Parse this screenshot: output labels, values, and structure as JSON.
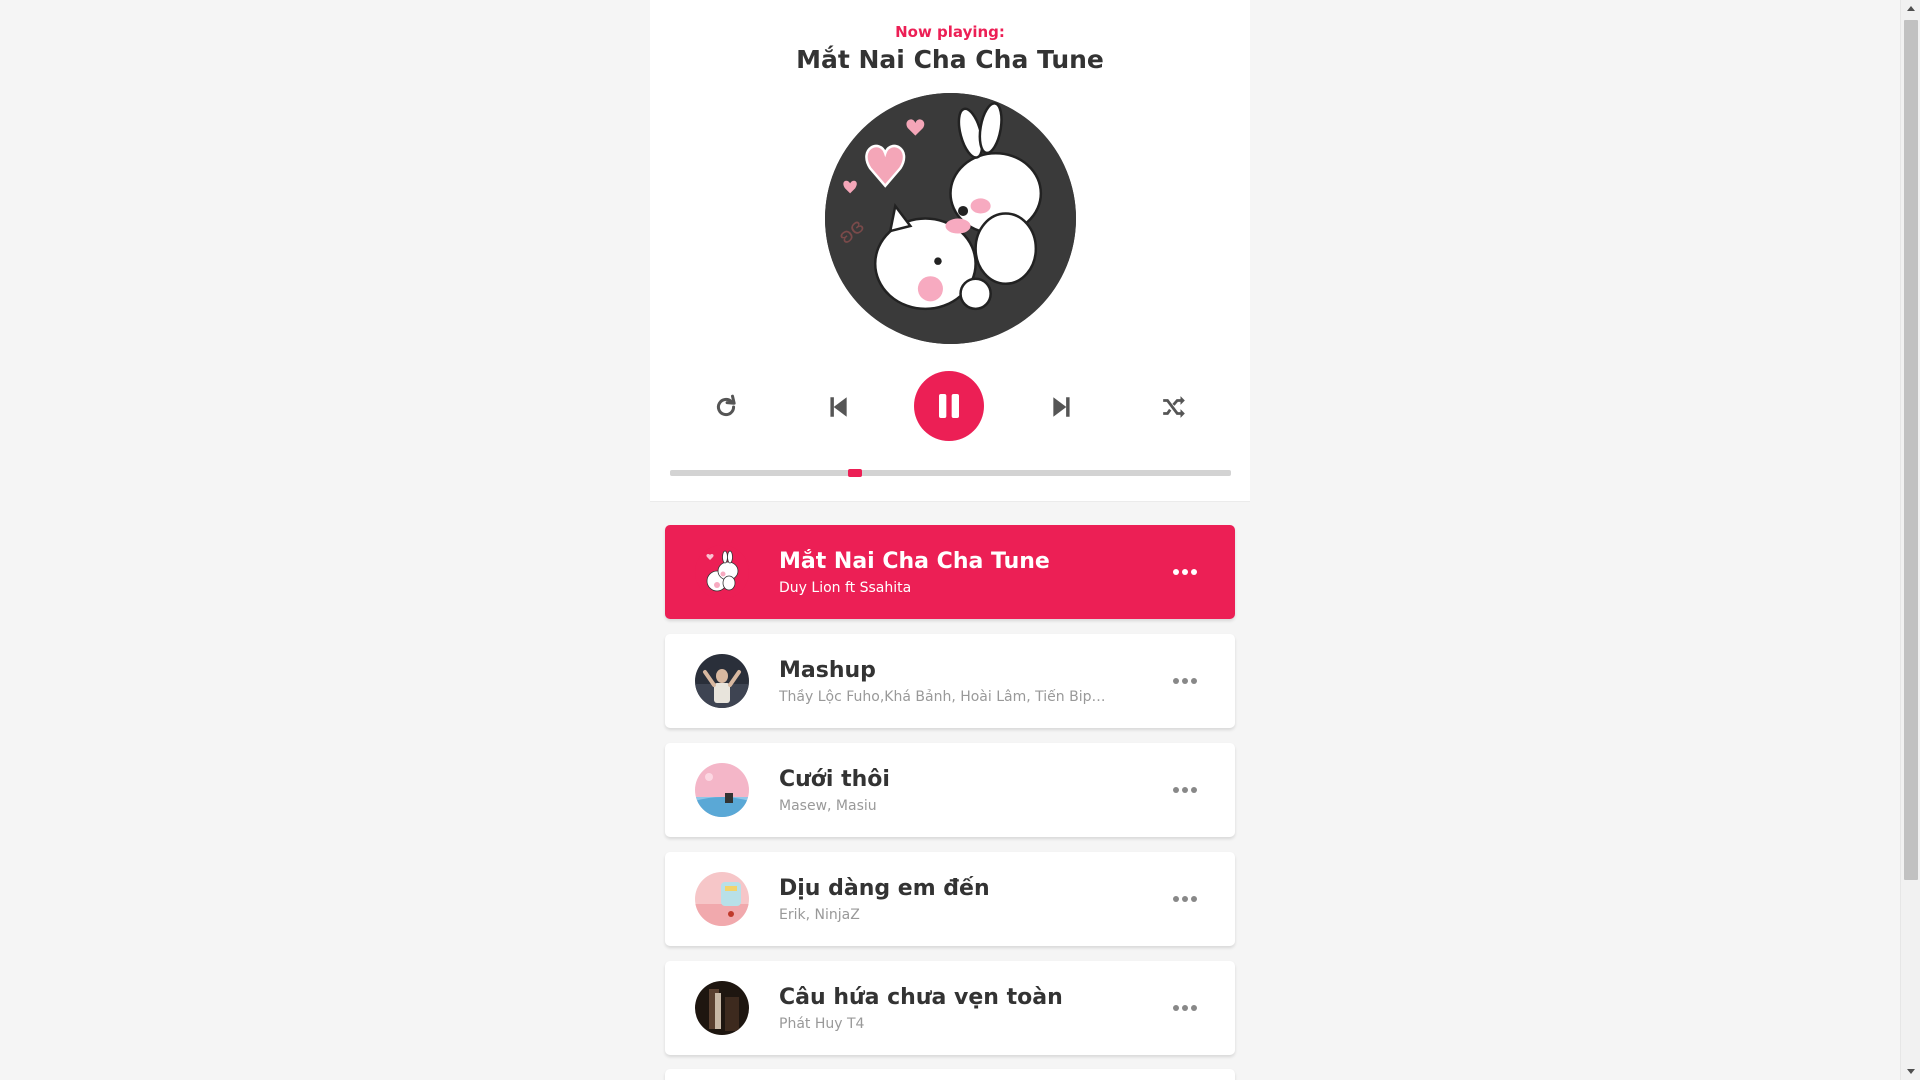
{
  "dashboard": {
    "label": "Now playing:",
    "current_title": "Mắt Nai Cha Cha Tune",
    "progress": 0.33
  },
  "controls": {
    "repeat_icon": "repeat-icon",
    "prev_icon": "skip-back-icon",
    "play_icon": "pause-icon",
    "next_icon": "skip-forward-icon",
    "random_icon": "shuffle-icon"
  },
  "colors": {
    "accent": "#ec1f55",
    "text": "#333333",
    "muted": "#999999",
    "background": "#f5f5f5"
  },
  "playlist": [
    {
      "title": "Mắt Nai Cha Cha Tune",
      "author": "Duy Lion ft Ssahita",
      "active": true
    },
    {
      "title": "Mashup",
      "author": "Thầy Lộc Fuho,Khá Bảnh, Hoài Lâm, Tiến Bip,...",
      "active": false
    },
    {
      "title": "Cưới thôi",
      "author": "Masew, Masiu",
      "active": false
    },
    {
      "title": "Dịu dàng em đến",
      "author": "Erik, NinjaZ",
      "active": false
    },
    {
      "title": "Câu hứa chưa vẹn toàn",
      "author": "Phát Huy T4",
      "active": false
    }
  ]
}
